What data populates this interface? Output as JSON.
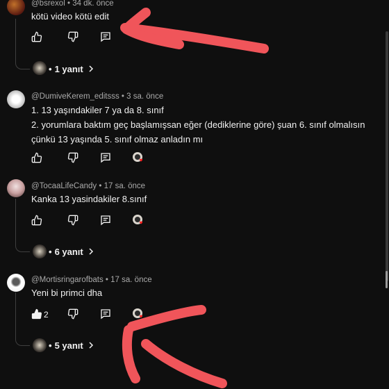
{
  "comments": [
    {
      "author": "@bsrexol",
      "time": "34 dk. önce",
      "text": "kötü video kötü edit",
      "replies": "1 yanıt"
    },
    {
      "author": "@DumiveKerem_editsss",
      "time": "3 sa. önce",
      "lines": [
        "1. 13 yaşındakiler 7 ya da 8. sınıf",
        "2. yorumlara baktım geç başlamışsan eğer (dediklerine göre) şuan 6. sınıf olmalısın",
        "çünkü 13 yaşında 5. sınıf olmaz anladın mı"
      ]
    },
    {
      "author": "@TocaaLifeCandy",
      "time": "17 sa. önce",
      "text": "Kanka 13 yasindakiler 8.sınıf",
      "replies": "6 yanıt"
    },
    {
      "author": "@Mortisringarofbats",
      "time": "17 sa. önce",
      "text": "Yeni bi primci dha",
      "likes": "2",
      "replies": "5 yanıt"
    }
  ],
  "separator": "•",
  "icons": [
    "like-icon",
    "dislike-icon",
    "reply-icon",
    "creator-heart-icon",
    "chevron-right-icon"
  ],
  "colors": {
    "background": "#0f0f0f",
    "annotation": "#f0555a",
    "meta": "#aaaaaa"
  }
}
